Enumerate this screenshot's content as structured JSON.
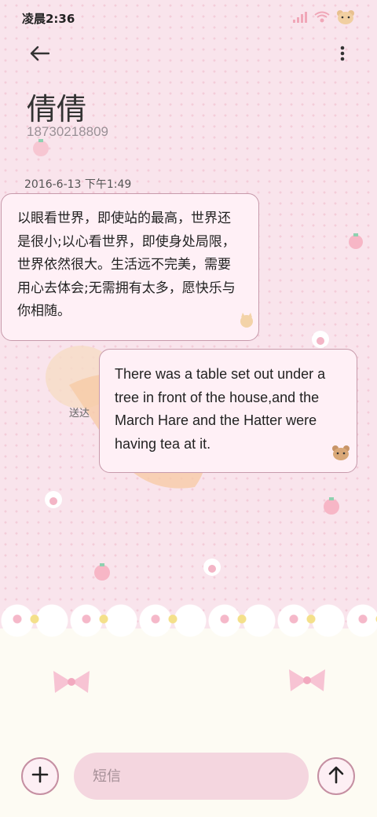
{
  "status_bar": {
    "time": "凌晨2:36",
    "icons": [
      "signal-icon",
      "wifi-icon",
      "bear-icon"
    ]
  },
  "header": {
    "back_icon": "arrow-left-icon",
    "more_icon": "more-vertical-icon"
  },
  "contact": {
    "name": "倩倩",
    "number": "18730218809"
  },
  "conversation": {
    "timestamp": "2016-6-13 下午1:49",
    "messages": [
      {
        "direction": "incoming",
        "text": "以眼看世界，即使站的最高，世界还是很小;以心看世界，即使身处局限，世界依然很大。生活远不完美，需要用心去体会;无需拥有太多，愿快乐与你相随。"
      },
      {
        "direction": "outgoing",
        "text": "There was a table set out under a tree in front of the house,and the March Hare and the Hatter were having tea at it.",
        "status": "送达"
      }
    ]
  },
  "composer": {
    "placeholder": "短信",
    "value": "",
    "add_icon": "plus-icon",
    "send_icon": "arrow-up-icon"
  },
  "colors": {
    "background": "#f9e4ec",
    "bubble_fill": "#fff0f6",
    "bubble_border": "#c79aab",
    "input_fill": "#f4d6df",
    "cream": "#fdfbf3"
  }
}
